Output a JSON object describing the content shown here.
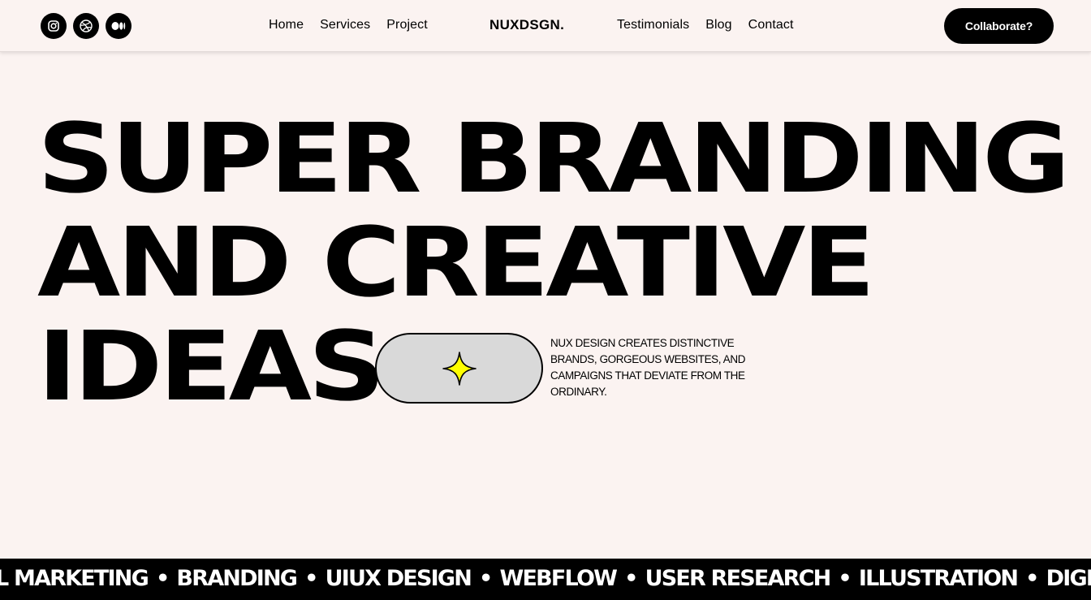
{
  "header": {
    "socials": [
      {
        "icon": "instagram-icon"
      },
      {
        "icon": "dribbble-icon"
      },
      {
        "icon": "medium-icon"
      }
    ],
    "nav_left": [
      "Home",
      "Services",
      "Project"
    ],
    "logo": "NUXDSGN.",
    "nav_right": [
      "Testimonials",
      "Blog",
      "Contact"
    ],
    "cta_label": "Collaborate?"
  },
  "hero": {
    "line1": "SUPER BRANDING",
    "line2": "AND CREATIVE",
    "line3": "IDEAS",
    "pill_icon": "sparkle-icon",
    "tagline": "NUX DESIGN CREATES DISTINCTIVE BRANDS, GORGEOUS WEBSITES, AND CAMPAIGNS THAT DEVIATE FROM THE ORDINARY."
  },
  "marquee": {
    "items": [
      "L MARKETING",
      "BRANDING",
      "UIUX DESIGN",
      "WEBFLOW",
      "USER RESEARCH",
      "ILLUSTRATION",
      "DIGITA"
    ],
    "separator": "•"
  },
  "colors": {
    "background": "#fbf3f1",
    "accent": "#000000",
    "sparkle": "#ffff00",
    "pill": "#d9d9d9"
  }
}
